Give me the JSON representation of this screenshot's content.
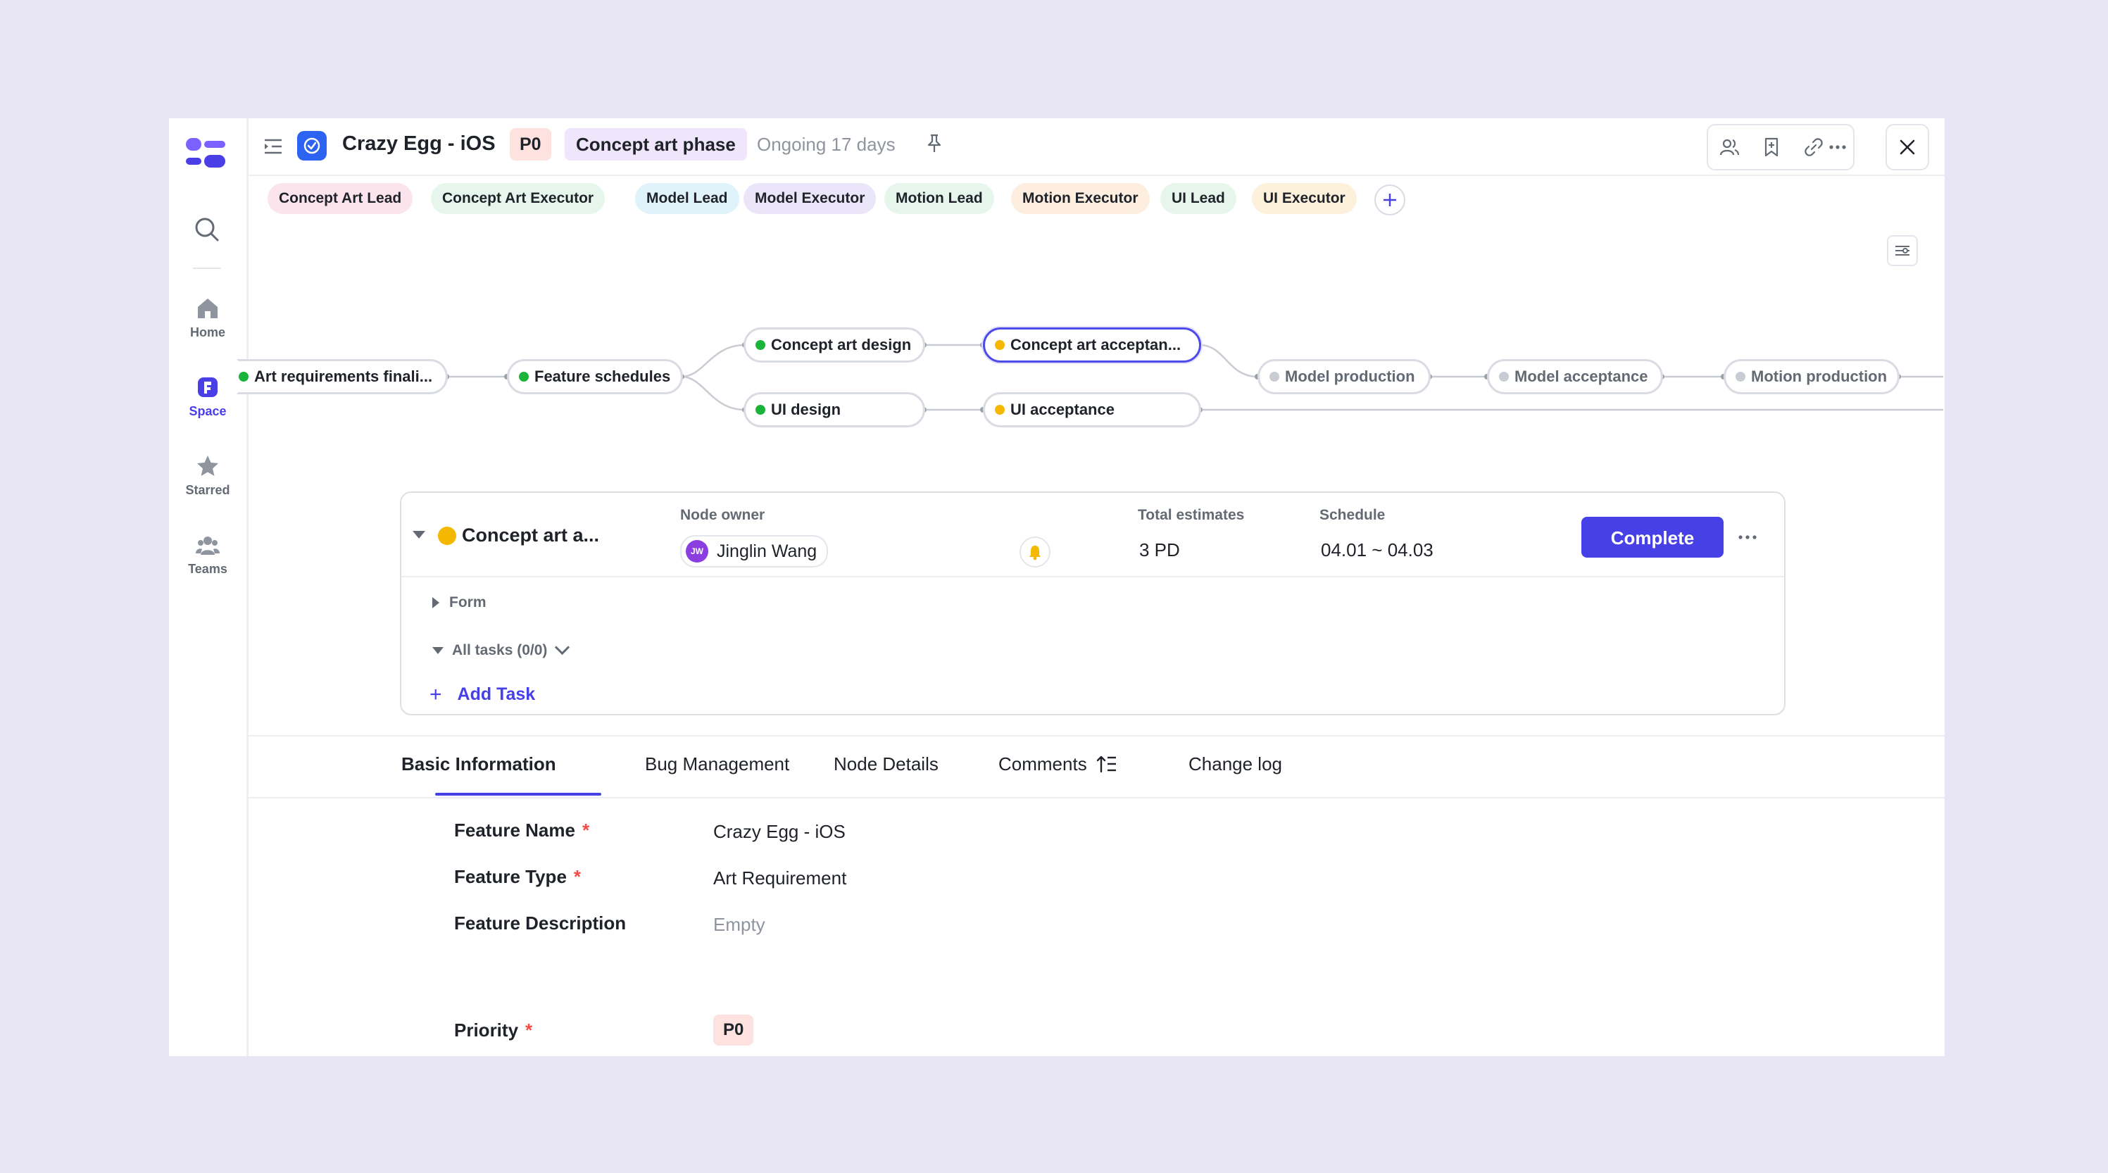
{
  "header": {
    "title": "Crazy Egg - iOS",
    "priority": "P0",
    "phase": "Concept art phase",
    "status": "Ongoing 17 days"
  },
  "rail": {
    "items": [
      {
        "label": "Home"
      },
      {
        "label": "Space"
      },
      {
        "label": "Starred"
      },
      {
        "label": "Teams"
      }
    ]
  },
  "roles": [
    {
      "label": "Concept Art Lead",
      "color": "#fce4ec"
    },
    {
      "label": "Concept Art Executor",
      "color": "#e6f6ec"
    },
    {
      "label": "Model Lead",
      "color": "#e0f3fb"
    },
    {
      "label": "Model Executor",
      "color": "#ebe5fa"
    },
    {
      "label": "Motion Lead",
      "color": "#e6f6ec"
    },
    {
      "label": "Motion Executor",
      "color": "#fdeee0"
    },
    {
      "label": "UI Lead",
      "color": "#e6f6ec"
    },
    {
      "label": "UI Executor",
      "color": "#fdf1dc"
    }
  ],
  "flow": {
    "nodes": [
      {
        "label": "Art requirements finali...",
        "status": "done"
      },
      {
        "label": "Feature schedules",
        "status": "done"
      },
      {
        "label": "Concept art design",
        "status": "done"
      },
      {
        "label": "UI design",
        "status": "done"
      },
      {
        "label": "Concept art acceptan...",
        "status": "in-progress"
      },
      {
        "label": "UI acceptance",
        "status": "in-progress"
      },
      {
        "label": "Model production",
        "status": "pending"
      },
      {
        "label": "Model acceptance",
        "status": "pending"
      },
      {
        "label": "Motion production",
        "status": "pending"
      }
    ]
  },
  "node_card": {
    "name": "Concept art a...",
    "owner_label": "Node owner",
    "owner_initials": "JW",
    "owner_name": "Jinglin Wang",
    "estimates_label": "Total estimates",
    "estimates_value": "3 PD",
    "schedule_label": "Schedule",
    "schedule_value": "04.01 ~ 04.03",
    "complete_label": "Complete",
    "form_label": "Form",
    "tasks_label": "All tasks (0/0)",
    "add_task_label": "Add Task"
  },
  "tabs": [
    {
      "label": "Basic Information",
      "active": true
    },
    {
      "label": "Bug Management"
    },
    {
      "label": "Node Details"
    },
    {
      "label": "Comments"
    },
    {
      "label": "Change log"
    }
  ],
  "fields": {
    "feature_name": {
      "label": "Feature Name",
      "value": "Crazy Egg - iOS"
    },
    "feature_type": {
      "label": "Feature Type",
      "value": "Art Requirement"
    },
    "feature_description": {
      "label": "Feature Description",
      "value": "Empty"
    },
    "priority": {
      "label": "Priority",
      "value": "P0"
    }
  },
  "colors": {
    "accent": "#4640e6",
    "done": "#1bb43b",
    "in_progress": "#f5b800",
    "pending": "#c9ccd2",
    "required": "#f54a45"
  }
}
